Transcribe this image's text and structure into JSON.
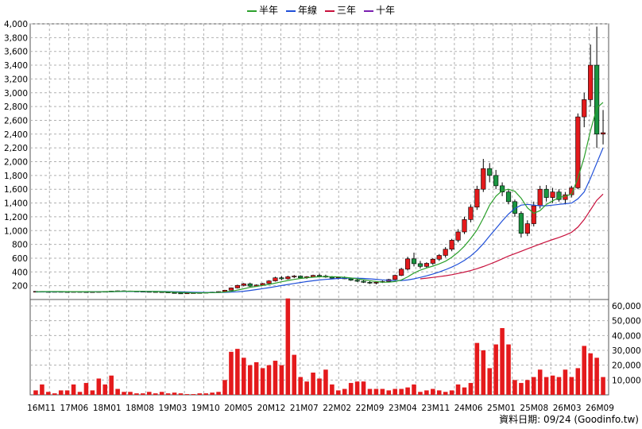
{
  "legend": [
    {
      "label": "半年",
      "color": "#2ca02c"
    },
    {
      "label": "年線",
      "color": "#1f4fd8"
    },
    {
      "label": "三年",
      "color": "#c8103c"
    },
    {
      "label": "十年",
      "color": "#7a1fb0"
    }
  ],
  "footer": "資料日期: 09/24  (Goodinfo.tw)",
  "chart_data": {
    "type": "candlestick+bar",
    "price_axis": {
      "ticks": [
        200,
        400,
        600,
        800,
        1000,
        1200,
        1400,
        1600,
        1800,
        2000,
        2200,
        2400,
        2600,
        2800,
        3000,
        3200,
        3400,
        3600,
        3800,
        4000
      ],
      "labels": [
        "200",
        "400",
        "600",
        "800",
        "1,000",
        "1,200",
        "1,400",
        "1,600",
        "1,800",
        "2,000",
        "2,200",
        "2,400",
        "2,600",
        "2,800",
        "3,000",
        "3,200",
        "3,400",
        "3,600",
        "3,800",
        "4,000"
      ],
      "min": 0,
      "max": 4000
    },
    "volume_axis": {
      "ticks": [
        10000,
        20000,
        30000,
        40000,
        50000,
        60000
      ],
      "labels": [
        "10,000",
        "20,000",
        "30,000",
        "40,000",
        "50,000",
        "60,000"
      ],
      "min": 0,
      "max": 60000
    },
    "x_labels": [
      "16M11",
      "17M06",
      "18M01",
      "18M08",
      "19M03",
      "19M10",
      "20M05",
      "20M12",
      "21M07",
      "22M02",
      "22M09",
      "23M04",
      "23M11",
      "24M06",
      "25M01",
      "25M08",
      "26M03",
      "26M09"
    ],
    "candles": [
      [
        115,
        120,
        108,
        118
      ],
      [
        118,
        122,
        112,
        115
      ],
      [
        115,
        119,
        110,
        113
      ],
      [
        113,
        118,
        108,
        116
      ],
      [
        116,
        120,
        112,
        114
      ],
      [
        114,
        118,
        110,
        112
      ],
      [
        112,
        117,
        108,
        115
      ],
      [
        115,
        119,
        111,
        113
      ],
      [
        113,
        116,
        109,
        111
      ],
      [
        111,
        115,
        107,
        113
      ],
      [
        113,
        117,
        109,
        115
      ],
      [
        115,
        120,
        112,
        118
      ],
      [
        118,
        126,
        115,
        122
      ],
      [
        122,
        130,
        118,
        126
      ],
      [
        126,
        132,
        120,
        124
      ],
      [
        124,
        128,
        118,
        121
      ],
      [
        121,
        125,
        115,
        119
      ],
      [
        119,
        123,
        112,
        116
      ],
      [
        116,
        120,
        110,
        114
      ],
      [
        114,
        118,
        108,
        112
      ],
      [
        112,
        116,
        104,
        108
      ],
      [
        108,
        112,
        96,
        100
      ],
      [
        100,
        106,
        88,
        94
      ],
      [
        94,
        100,
        84,
        90
      ],
      [
        90,
        98,
        86,
        95
      ],
      [
        95,
        102,
        90,
        98
      ],
      [
        98,
        104,
        92,
        100
      ],
      [
        100,
        108,
        95,
        104
      ],
      [
        104,
        112,
        99,
        108
      ],
      [
        108,
        118,
        102,
        115
      ],
      [
        115,
        140,
        112,
        135
      ],
      [
        135,
        175,
        130,
        168
      ],
      [
        168,
        215,
        160,
        205
      ],
      [
        205,
        240,
        190,
        228
      ],
      [
        228,
        245,
        180,
        195
      ],
      [
        195,
        220,
        185,
        210
      ],
      [
        210,
        240,
        200,
        232
      ],
      [
        232,
        280,
        225,
        270
      ],
      [
        270,
        330,
        260,
        315
      ],
      [
        315,
        340,
        280,
        300
      ],
      [
        300,
        345,
        290,
        330
      ],
      [
        330,
        355,
        310,
        340
      ],
      [
        340,
        350,
        300,
        315
      ],
      [
        315,
        340,
        300,
        330
      ],
      [
        330,
        360,
        320,
        350
      ],
      [
        350,
        375,
        330,
        340
      ],
      [
        340,
        360,
        315,
        325
      ],
      [
        325,
        340,
        300,
        310
      ],
      [
        310,
        330,
        290,
        320
      ],
      [
        320,
        335,
        295,
        300
      ],
      [
        300,
        315,
        270,
        280
      ],
      [
        280,
        295,
        255,
        265
      ],
      [
        265,
        280,
        240,
        250
      ],
      [
        250,
        265,
        225,
        238
      ],
      [
        238,
        260,
        220,
        250
      ],
      [
        250,
        275,
        240,
        262
      ],
      [
        262,
        300,
        255,
        290
      ],
      [
        290,
        360,
        280,
        350
      ],
      [
        350,
        460,
        340,
        440
      ],
      [
        440,
        620,
        420,
        590
      ],
      [
        590,
        680,
        480,
        520
      ],
      [
        520,
        560,
        450,
        480
      ],
      [
        480,
        540,
        460,
        525
      ],
      [
        525,
        600,
        500,
        585
      ],
      [
        585,
        660,
        560,
        640
      ],
      [
        640,
        760,
        610,
        730
      ],
      [
        730,
        880,
        700,
        860
      ],
      [
        860,
        1020,
        830,
        980
      ],
      [
        980,
        1200,
        950,
        1160
      ],
      [
        1160,
        1380,
        1120,
        1340
      ],
      [
        1340,
        1650,
        1300,
        1600
      ],
      [
        1600,
        2040,
        1560,
        1900
      ],
      [
        1900,
        1980,
        1700,
        1800
      ],
      [
        1800,
        1880,
        1600,
        1650
      ],
      [
        1650,
        1700,
        1500,
        1560
      ],
      [
        1560,
        1600,
        1380,
        1420
      ],
      [
        1420,
        1450,
        1200,
        1250
      ],
      [
        1250,
        1280,
        900,
        960
      ],
      [
        960,
        1150,
        920,
        1100
      ],
      [
        1100,
        1420,
        1060,
        1360
      ],
      [
        1360,
        1650,
        1320,
        1600
      ],
      [
        1600,
        1660,
        1420,
        1480
      ],
      [
        1480,
        1620,
        1400,
        1560
      ],
      [
        1560,
        1600,
        1420,
        1450
      ],
      [
        1450,
        1560,
        1380,
        1520
      ],
      [
        1520,
        1650,
        1480,
        1620
      ],
      [
        1620,
        2700,
        1600,
        2650
      ],
      [
        2650,
        3000,
        2500,
        2900
      ],
      [
        2900,
        3700,
        2800,
        3400
      ],
      [
        3400,
        3960,
        2200,
        2400
      ],
      [
        2400,
        2750,
        2250,
        2420
      ]
    ],
    "ma_half_year": [
      112,
      114,
      115,
      115,
      115,
      114,
      114,
      114,
      114,
      113,
      113,
      114,
      115,
      117,
      119,
      120,
      120,
      119,
      118,
      116,
      114,
      111,
      107,
      103,
      99,
      97,
      97,
      98,
      100,
      103,
      109,
      120,
      137,
      156,
      176,
      190,
      204,
      219,
      238,
      257,
      275,
      292,
      305,
      315,
      324,
      330,
      332,
      331,
      328,
      322,
      312,
      300,
      287,
      273,
      261,
      253,
      251,
      260,
      283,
      328,
      384,
      427,
      458,
      484,
      517,
      556,
      612,
      686,
      775,
      885,
      1010,
      1180,
      1370,
      1500,
      1580,
      1600,
      1570,
      1470,
      1330,
      1250,
      1290,
      1380,
      1430,
      1480,
      1500,
      1530,
      1760,
      2060,
      2450,
      2780,
      2860
    ],
    "ma_year": [
      110,
      111,
      112,
      112,
      113,
      113,
      113,
      113,
      113,
      113,
      113,
      113,
      114,
      115,
      116,
      117,
      117,
      117,
      117,
      117,
      116,
      115,
      113,
      111,
      108,
      106,
      104,
      103,
      103,
      103,
      104,
      107,
      112,
      120,
      131,
      144,
      158,
      172,
      187,
      203,
      218,
      233,
      247,
      260,
      272,
      283,
      292,
      299,
      305,
      309,
      310,
      309,
      306,
      300,
      293,
      285,
      278,
      273,
      275,
      283,
      300,
      320,
      344,
      370,
      399,
      432,
      470,
      514,
      567,
      632,
      712,
      810,
      922,
      1030,
      1140,
      1240,
      1320,
      1370,
      1380,
      1370,
      1360,
      1360,
      1370,
      1380,
      1390,
      1400,
      1460,
      1560,
      1760,
      1980,
      2200
    ],
    "ma_three_year": [
      null,
      null,
      null,
      null,
      null,
      null,
      null,
      null,
      null,
      null,
      null,
      null,
      null,
      null,
      null,
      null,
      null,
      null,
      null,
      null,
      null,
      null,
      null,
      null,
      null,
      null,
      null,
      null,
      null,
      null,
      null,
      null,
      null,
      null,
      null,
      null,
      null,
      null,
      null,
      null,
      null,
      null,
      null,
      null,
      null,
      null,
      null,
      null,
      null,
      null,
      null,
      null,
      null,
      null,
      null,
      null,
      null,
      null,
      null,
      null,
      null,
      300,
      310,
      320,
      332,
      345,
      360,
      378,
      398,
      420,
      447,
      478,
      513,
      550,
      590,
      630,
      665,
      700,
      735,
      770,
      805,
      838,
      870,
      900,
      935,
      975,
      1050,
      1160,
      1300,
      1440,
      1530
    ],
    "ma_ten_year": [
      null,
      null,
      null,
      null,
      null,
      null,
      null,
      null,
      null,
      null,
      null,
      null,
      null,
      null,
      null,
      null,
      null,
      null,
      null,
      null,
      null,
      null,
      null,
      null,
      null,
      null,
      null,
      null,
      null,
      null,
      null,
      null,
      null,
      null,
      null,
      null,
      null,
      null,
      null,
      null,
      null,
      null,
      null,
      null,
      null,
      null,
      null,
      null,
      null,
      null,
      null,
      null,
      null,
      null,
      null,
      null,
      null,
      null,
      null,
      null,
      null,
      null,
      null,
      null,
      null,
      null,
      null,
      null,
      null,
      null,
      null,
      null,
      null,
      null,
      null,
      null,
      null,
      null,
      null,
      null,
      null,
      null,
      null,
      null,
      null,
      null,
      null,
      null,
      null,
      null,
      null
    ],
    "volume": [
      3000,
      7000,
      2000,
      1000,
      3000,
      3000,
      7000,
      2000,
      8000,
      3000,
      11000,
      7000,
      13000,
      4000,
      2000,
      2000,
      1000,
      1000,
      2000,
      1000,
      2000,
      1000,
      1500,
      1000,
      500,
      500,
      1000,
      1000,
      1500,
      2000,
      10000,
      29000,
      31000,
      25000,
      20000,
      22000,
      18000,
      20000,
      23000,
      20000,
      65000,
      27000,
      12000,
      9000,
      15000,
      11000,
      17000,
      7000,
      3000,
      4000,
      8000,
      9000,
      9000,
      4000,
      4000,
      4000,
      3000,
      4000,
      4000,
      5000,
      7000,
      2000,
      3000,
      4000,
      3000,
      2000,
      3000,
      7000,
      5000,
      8000,
      35000,
      30000,
      18000,
      34000,
      45000,
      34000,
      10000,
      8000,
      10000,
      12000,
      17000,
      12000,
      13000,
      12000,
      17000,
      12000,
      18000,
      33000,
      28000,
      25000,
      12000
    ]
  }
}
